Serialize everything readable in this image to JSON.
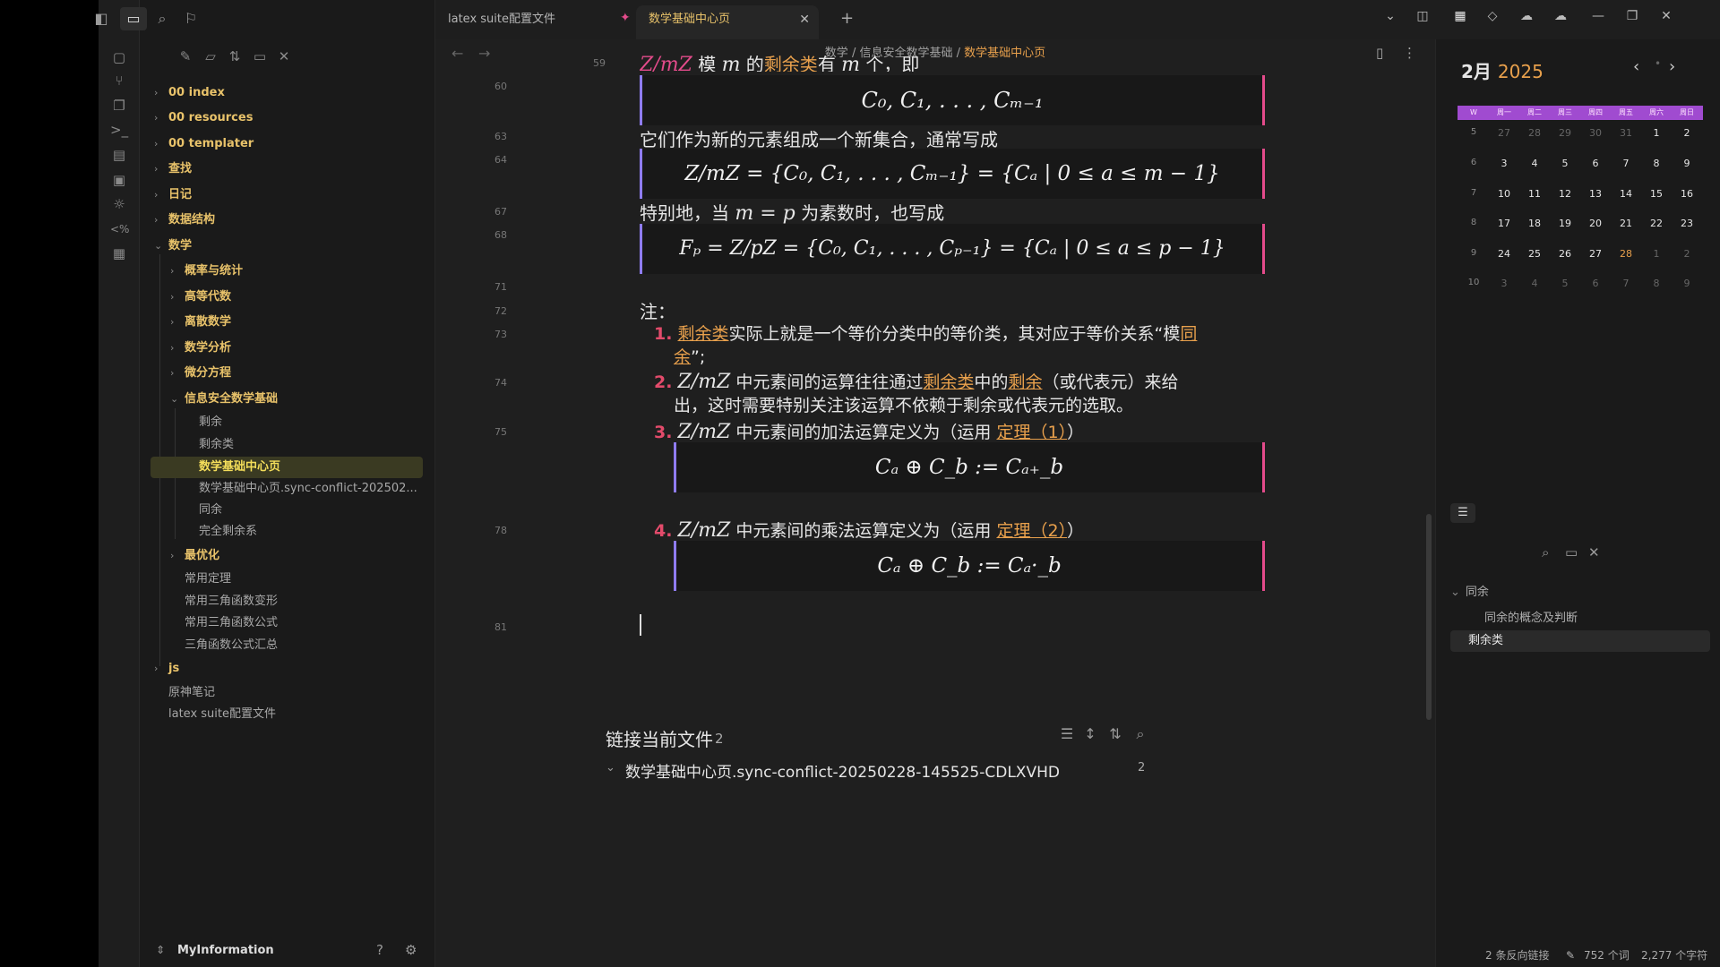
{
  "tabs": [
    {
      "label": "latex suite配置文件"
    },
    {
      "label": "数学基础中心页"
    }
  ],
  "breadcrumb": {
    "part1": "数学",
    "sep": "/",
    "part2": "信息安全数学基础",
    "current": "数学基础中心页"
  },
  "sidebar": {
    "items": [
      {
        "label": "00 index"
      },
      {
        "label": "00 resources"
      },
      {
        "label": "00 templater"
      },
      {
        "label": "查找"
      },
      {
        "label": "日记"
      },
      {
        "label": "数据结构"
      },
      {
        "label": "数学"
      },
      {
        "label": "概率与统计"
      },
      {
        "label": "高等代数"
      },
      {
        "label": "离散数学"
      },
      {
        "label": "数学分析"
      },
      {
        "label": "微分方程"
      },
      {
        "label": "信息安全数学基础"
      },
      {
        "label": "剩余"
      },
      {
        "label": "剩余类"
      },
      {
        "label": "数学基础中心页"
      },
      {
        "label": "数学基础中心页.sync-conflict-202502..."
      },
      {
        "label": "同余"
      },
      {
        "label": "完全剩余系"
      },
      {
        "label": "最优化"
      },
      {
        "label": "常用定理"
      },
      {
        "label": "常用三角函数变形"
      },
      {
        "label": "常用三角函数公式"
      },
      {
        "label": "三角函数公式汇总"
      },
      {
        "label": "js"
      },
      {
        "label": "原神笔记"
      },
      {
        "label": "latex suite配置文件"
      }
    ],
    "vault_name": "MyInformation"
  },
  "editor": {
    "ln": {
      "l59": "59",
      "l60": "60",
      "l63": "63",
      "l64": "64",
      "l67": "67",
      "l68": "68",
      "l71": "71",
      "l72": "72",
      "l73": "73",
      "l74": "74",
      "l75": "75",
      "l78": "78",
      "l81": "81"
    },
    "line59_math": "Z/mZ",
    "line59_a": " 模 ",
    "line59_m": "m",
    "line59_b": " 的",
    "line59_link": "剩余类",
    "line59_c": "有 ",
    "line59_mm": "m",
    "line59_d": " 个，即",
    "math60": "C₀, C₁, . . . , Cₘ₋₁",
    "line63": "它们作为新的元素组成一个新集合，通常写成",
    "math64": "Z/mZ = {C₀, C₁, . . . , Cₘ₋₁} = {Cₐ | 0 ≤ a ≤ m − 1}",
    "line67_a": "特别地，当 ",
    "line67_math": "m = p",
    "line67_b": " 为素数时，也写成",
    "math68": "Fₚ = Z/pZ = {C₀, C₁, . . . , Cₚ₋₁} = {Cₐ | 0 ≤ a ≤ p − 1}",
    "line72": "注：",
    "item1_num": "1.",
    "item1_link": "剩余类",
    "item1_text": "实际上就是一个等价分类中的等价类，其对应于等价关系“模",
    "item1_link2a": "同",
    "item1_link2b": "余",
    "item1_end": "”;",
    "item2_num": "2.",
    "item2_math": "Z/mZ",
    "item2_a": " 中元素间的运算往往通过",
    "item2_link1": "剩余类",
    "item2_b": "中的",
    "item2_link2": "剩余",
    "item2_c": "（或代表元）来给",
    "item2_d": "出，这时需要特别关注该运算不依赖于剩余或代表元的选取。",
    "item3_num": "3.",
    "item3_math": "Z/mZ",
    "item3_a": " 中元素间的加法运算定义为（运用 ",
    "item3_link": "定理（1）",
    "item3_end": "）",
    "math76": "Cₐ ⊕ C_b := Cₐ₊_b",
    "item4_num": "4.",
    "item4_math": "Z/mZ",
    "item4_a": " 中元素间的乘法运算定义为（运用 ",
    "item4_link": "定理（2）",
    "item4_end": "）",
    "math79": "Cₐ ⊕ C_b := Cₐ·_b"
  },
  "backlinks": {
    "title": "链接当前文件",
    "count": "2",
    "file": "数学基础中心页.sync-conflict-20250228-145525-CDLXVHD",
    "file_count": "2"
  },
  "calendar": {
    "month": "2月",
    "year": "2025",
    "headers": [
      "W",
      "周一",
      "周二",
      "周三",
      "周四",
      "周五",
      "周六",
      "周日"
    ],
    "rows": [
      [
        "5",
        "27",
        "28",
        "29",
        "30",
        "31",
        "1",
        "2"
      ],
      [
        "6",
        "3",
        "4",
        "5",
        "6",
        "7",
        "8",
        "9"
      ],
      [
        "7",
        "10",
        "11",
        "12",
        "13",
        "14",
        "15",
        "16"
      ],
      [
        "8",
        "17",
        "18",
        "19",
        "20",
        "21",
        "22",
        "23"
      ],
      [
        "9",
        "24",
        "25",
        "26",
        "27",
        "28",
        "1",
        "2"
      ],
      [
        "10",
        "3",
        "4",
        "5",
        "6",
        "7",
        "8",
        "9"
      ]
    ]
  },
  "outline": {
    "items": [
      {
        "label": "同余"
      },
      {
        "label": "同余的概念及判断"
      },
      {
        "label": "剩余类"
      }
    ]
  },
  "status": {
    "backlinks": "2 条反向链接",
    "words": "752 个词",
    "chars": "2,277 个字符"
  },
  "colors": {
    "accent": "#e8a04c",
    "folder": "#e8c26a",
    "math_left": "#8f7cf0",
    "math_right": "#e34b8b",
    "calendar_header": "#a04bd0"
  }
}
